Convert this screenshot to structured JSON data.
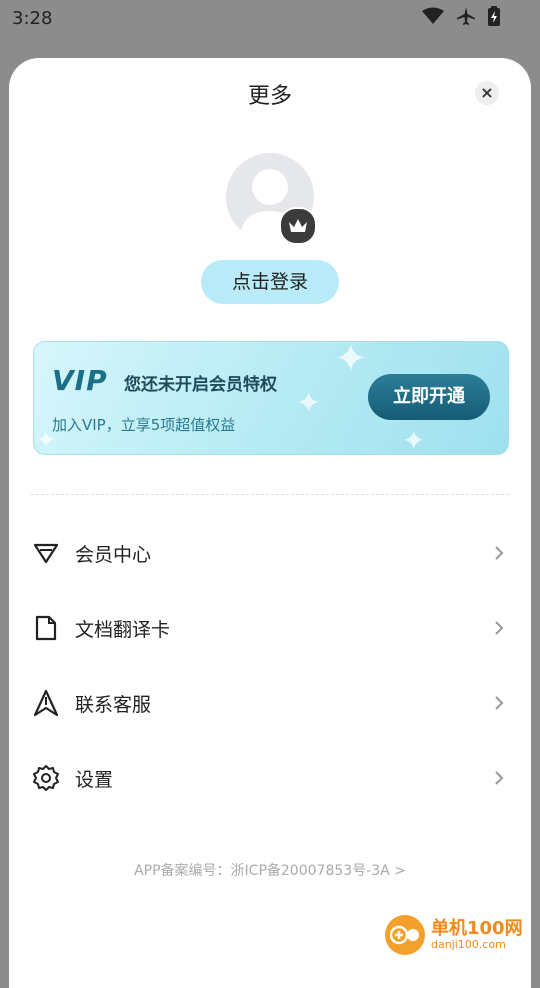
{
  "status_bar": {
    "time": "3:28",
    "icons": [
      "wifi-icon",
      "airplane-icon",
      "battery-icon"
    ]
  },
  "sheet": {
    "title": "更多",
    "close_icon": "close-icon"
  },
  "profile": {
    "login_label": "点击登录",
    "badge_icon": "crown-icon"
  },
  "vip_card": {
    "logo_text": "VIP",
    "headline": "您还未开启会员特权",
    "subtext": "加入VIP，立享5项超值权益",
    "open_label": "立即开通"
  },
  "menu": {
    "items": [
      {
        "label": "会员中心",
        "icon": "diamond-icon"
      },
      {
        "label": "文档翻译卡",
        "icon": "document-icon"
      },
      {
        "label": "联系客服",
        "icon": "navigation-icon"
      },
      {
        "label": "设置",
        "icon": "gear-icon"
      }
    ]
  },
  "footer": {
    "icp_text": "APP备案编号：浙ICP备20007853号-3A >"
  },
  "watermark": {
    "main": "单机100网",
    "sub": "danji100.com"
  },
  "colors": {
    "accent_light": "#b8ebf7",
    "vip_button": "#1b6f86",
    "text": "#222222",
    "muted": "#aaaaaa"
  }
}
